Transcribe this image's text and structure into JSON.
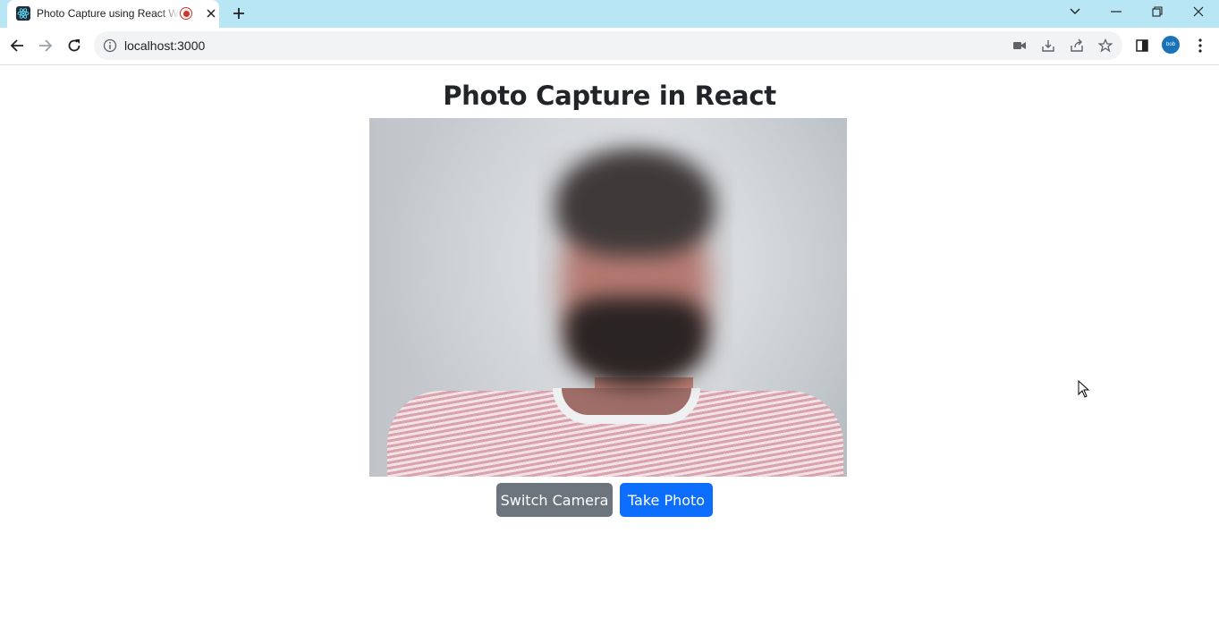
{
  "browser": {
    "tab": {
      "title": "Photo Capture using React W",
      "favicon": "react-icon"
    },
    "address": {
      "url": "localhost:3000"
    },
    "profile_label": "bob"
  },
  "page": {
    "title": "Photo Capture in React",
    "buttons": {
      "switch_camera": "Switch Camera",
      "take_photo": "Take Photo"
    }
  },
  "colors": {
    "primary": "#0d6efd",
    "secondary": "#6c757d",
    "tabstrip": "#b8e6f4"
  }
}
